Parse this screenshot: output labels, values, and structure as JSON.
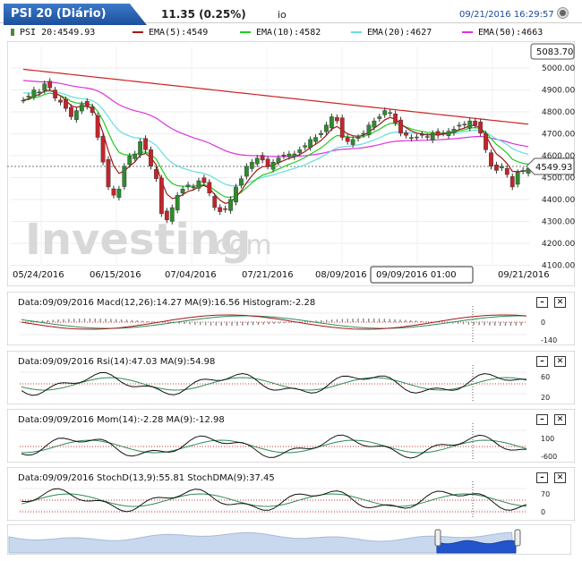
{
  "header": {
    "title": "PSI 20 (Diário)",
    "price_change": "11.35 (0.25%)",
    "extra": "io",
    "datetime": "09/21/2016 16:29:57",
    "settings_icon": "gear-icon"
  },
  "legend": [
    {
      "label": "PSI 20:4549.93",
      "color": "#4a8a3a"
    },
    {
      "label": "EMA(5):4549",
      "color": "#a01818"
    },
    {
      "label": "EMA(10):4582",
      "color": "#22cc22"
    },
    {
      "label": "EMA(20):4627",
      "color": "#66dddd"
    },
    {
      "label": "EMA(50):4663",
      "color": "#dd33dd"
    }
  ],
  "main_chart": {
    "y_ticks": [
      "5000.00",
      "4900.00",
      "4800.00",
      "4700.00",
      "4600.00",
      "4500.00",
      "4400.00",
      "4300.00",
      "4200.00",
      "4100.00"
    ],
    "high_label": "5083.70",
    "last_label": "4549.93",
    "x_ticks": [
      "05/24/2016",
      "06/15/2016",
      "07/04/2016",
      "07/21/2016",
      "08/09/2016",
      "09/09/2016 01:00",
      "09/21/2016"
    ],
    "watermark_a": "Investing",
    "watermark_b": ".com"
  },
  "macd": {
    "header": "Data:09/09/2016 Macd(12,26):14.27 MA(9):16.56 Histogram:-2.28",
    "ticks": [
      "0",
      "-140"
    ]
  },
  "rsi": {
    "header": "Data:09/09/2016 Rsi(14):47.03 MA(9):54.98",
    "ticks": [
      "60",
      "20"
    ]
  },
  "mom": {
    "header": "Data:09/09/2016 Mom(14):-2.28 MA(9):-12.98",
    "ticks": [
      "100",
      "-600"
    ]
  },
  "stoch": {
    "header": "Data:09/09/2016 StochD(13,9):55.81 StochDMA(9):37.45",
    "ticks": [
      "70",
      "0"
    ]
  },
  "buttons": {
    "minus": "–",
    "close": "✕"
  },
  "colors": {
    "up": "#2e8b2e",
    "down": "#c0262b",
    "accent": "#1b4f9c"
  },
  "chart_data": {
    "type": "line",
    "title": "PSI 20 (Diário)",
    "ylim": [
      4100,
      5083.7
    ],
    "x": [
      "05/24/2016",
      "06/15/2016",
      "07/04/2016",
      "07/21/2016",
      "08/09/2016",
      "09/09/2016",
      "09/21/2016"
    ],
    "close": [
      4880,
      4560,
      4330,
      4600,
      4710,
      4720,
      4549.93
    ],
    "series": [
      {
        "name": "EMA(5)",
        "values": [
          4880,
          4620,
          4420,
          4560,
          4700,
          4720,
          4549
        ]
      },
      {
        "name": "EMA(10)",
        "values": [
          4880,
          4680,
          4460,
          4530,
          4690,
          4710,
          4582
        ]
      },
      {
        "name": "EMA(20)",
        "values": [
          4900,
          4730,
          4560,
          4590,
          4670,
          4700,
          4627
        ]
      },
      {
        "name": "EMA(50)",
        "values": [
          4900,
          4780,
          4680,
          4650,
          4670,
          4700,
          4663
        ]
      }
    ]
  }
}
